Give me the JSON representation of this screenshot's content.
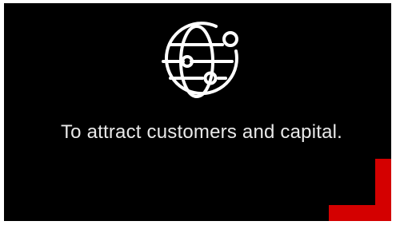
{
  "slide": {
    "icon": "globe-network-icon",
    "caption": "To attract customers and capital.",
    "colors": {
      "background": "#000000",
      "text": "#e9e9e9",
      "icon": "#ffffff",
      "accent": "#d40000"
    }
  }
}
